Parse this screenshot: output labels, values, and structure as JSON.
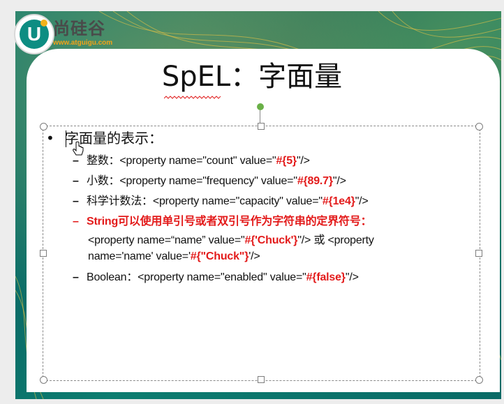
{
  "logo": {
    "mark": "U",
    "brand": "尚硅谷",
    "url": "www.atguigu.com"
  },
  "slide": {
    "title": "SpEL：字面量",
    "heading": "字面量的表示：",
    "items": [
      {
        "label": "整数：",
        "code_prefix": "<property name=\"count\" value=\"",
        "expr": "#{5}",
        "code_suffix": "\"/>"
      },
      {
        "label": "小数：",
        "code_prefix": "<property name=\"frequency\" value=\"",
        "expr": "#{89.7}",
        "code_suffix": "\"/>"
      },
      {
        "label": "科学计数法：",
        "code_prefix": "<property name=\"capacity\" value=\"",
        "expr": "#{1e4}",
        "code_suffix": "\"/>"
      },
      {
        "label_red": "String可以使用单引号或者双引号作为字符串的定界符号：",
        "line2_prefix": "<property name=“name” value=\"",
        "line2_expr": "#{'Chuck'}",
        "line2_suffix": "\"/> 或 <property",
        "line3_prefix": "name='name' value='",
        "line3_expr": "#{\"Chuck\"}",
        "line3_suffix": "'/>"
      },
      {
        "label": "Boolean：",
        "code_prefix": "<property name=\"enabled\" value=\"",
        "expr": "#{false}",
        "code_suffix": "\"/>"
      }
    ]
  },
  "colors": {
    "accent_red": "#e31b1b",
    "teal": "#0f7a73",
    "brand_orange": "#f2a319"
  }
}
